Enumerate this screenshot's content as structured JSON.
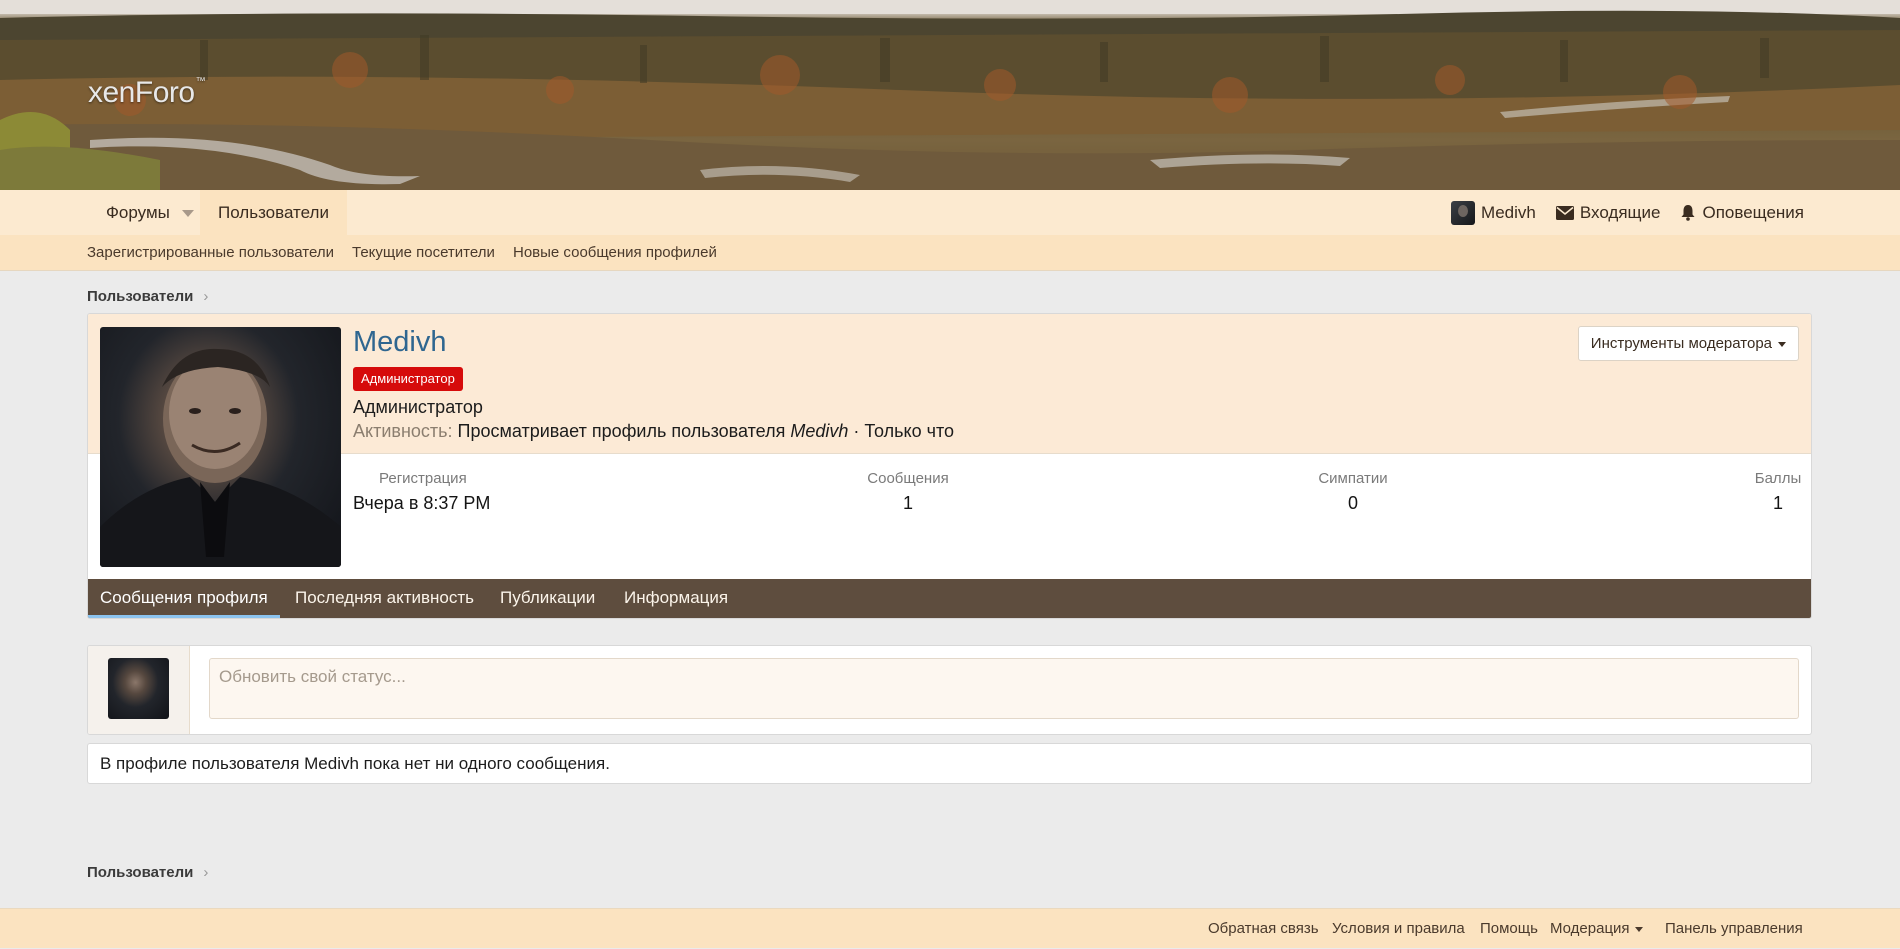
{
  "logo": {
    "text": "xenForo",
    "tm": "™"
  },
  "nav": {
    "tabs": [
      {
        "label": "Форумы"
      },
      {
        "label": "Пользователи"
      }
    ],
    "user_link": "Medivh",
    "inbox_label": "Входящие",
    "alerts_label": "Оповещения"
  },
  "subnav": {
    "items": [
      {
        "label": "Зарегистрированные пользователи"
      },
      {
        "label": "Текущие посетители"
      },
      {
        "label": "Новые сообщения профилей"
      }
    ]
  },
  "breadcrumb": {
    "label": "Пользователи",
    "separator": "›"
  },
  "profile": {
    "username": "Medivh",
    "badge": "Администратор",
    "title": "Администратор",
    "activity_key": "Активность:",
    "activity_text": "Просматривает профиль пользователя",
    "activity_user": "Medivh",
    "activity_time": "· Только что",
    "mod_tools": "Инструменты модератора",
    "stats": [
      {
        "label": "Регистрация",
        "value": "Вчера в 8:37 PM"
      },
      {
        "label": "Сообщения",
        "value": "1"
      },
      {
        "label": "Симпатии",
        "value": "0"
      },
      {
        "label": "Баллы",
        "value": "1"
      }
    ],
    "tabs": [
      {
        "label": "Сообщения профиля"
      },
      {
        "label": "Последняя активность"
      },
      {
        "label": "Публикации"
      },
      {
        "label": "Информация"
      }
    ]
  },
  "status": {
    "placeholder": "Обновить свой статус..."
  },
  "empty_message": "В профиле пользователя Medivh пока нет ни одного сообщения.",
  "footer_breadcrumb": {
    "label": "Пользователи",
    "separator": "›"
  },
  "footer": {
    "links": [
      {
        "label": "Обратная связь"
      },
      {
        "label": "Условия и правила"
      },
      {
        "label": "Помощь"
      },
      {
        "label": "Модерация"
      },
      {
        "label": "Панель управления"
      }
    ]
  },
  "colors": {
    "nav_bg": "#fcead0",
    "subnav_bg": "#fbe3c0",
    "tab_bar_bg": "#5e4d3e",
    "badge_bg": "#d60b0b",
    "username_color": "#2f6690"
  }
}
